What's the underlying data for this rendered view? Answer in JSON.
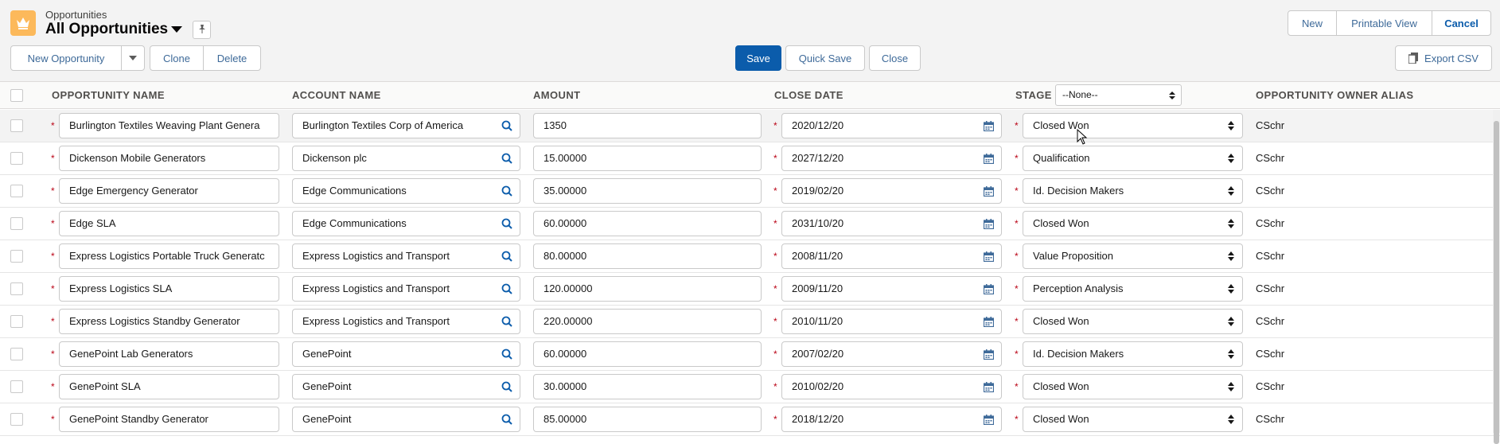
{
  "header": {
    "app_label": "Opportunities",
    "list_title": "All Opportunities",
    "buttons_left": [
      "New Opportunity",
      "Clone",
      "Delete"
    ],
    "buttons_center": [
      "Save",
      "Quick Save",
      "Close"
    ],
    "buttons_right_top": [
      "New",
      "Printable View",
      "Cancel"
    ],
    "export_label": "Export CSV"
  },
  "columns": {
    "name": "OPPORTUNITY NAME",
    "account": "ACCOUNT NAME",
    "amount": "AMOUNT",
    "close_date": "CLOSE DATE",
    "stage": "STAGE",
    "owner": "OPPORTUNITY OWNER ALIAS"
  },
  "stage_filter": "--None--",
  "rows": [
    {
      "name": "Burlington Textiles Weaving Plant Genera",
      "account": "Burlington Textiles Corp of America",
      "amount": "1350",
      "close_date": "2020/12/20",
      "stage": "Closed Won",
      "owner": "CSchr"
    },
    {
      "name": "Dickenson Mobile Generators",
      "account": "Dickenson plc",
      "amount": "15.00000",
      "close_date": "2027/12/20",
      "stage": "Qualification",
      "owner": "CSchr"
    },
    {
      "name": "Edge Emergency Generator",
      "account": "Edge Communications",
      "amount": "35.00000",
      "close_date": "2019/02/20",
      "stage": "Id. Decision Makers",
      "owner": "CSchr"
    },
    {
      "name": "Edge SLA",
      "account": "Edge Communications",
      "amount": "60.00000",
      "close_date": "2031/10/20",
      "stage": "Closed Won",
      "owner": "CSchr"
    },
    {
      "name": "Express Logistics Portable Truck Generatc",
      "account": "Express Logistics and Transport",
      "amount": "80.00000",
      "close_date": "2008/11/20",
      "stage": "Value Proposition",
      "owner": "CSchr"
    },
    {
      "name": "Express Logistics SLA",
      "account": "Express Logistics and Transport",
      "amount": "120.00000",
      "close_date": "2009/11/20",
      "stage": "Perception Analysis",
      "owner": "CSchr"
    },
    {
      "name": "Express Logistics Standby Generator",
      "account": "Express Logistics and Transport",
      "amount": "220.00000",
      "close_date": "2010/11/20",
      "stage": "Closed Won",
      "owner": "CSchr"
    },
    {
      "name": "GenePoint Lab Generators",
      "account": "GenePoint",
      "amount": "60.00000",
      "close_date": "2007/02/20",
      "stage": "Id. Decision Makers",
      "owner": "CSchr"
    },
    {
      "name": "GenePoint SLA",
      "account": "GenePoint",
      "amount": "30.00000",
      "close_date": "2010/02/20",
      "stage": "Closed Won",
      "owner": "CSchr"
    },
    {
      "name": "GenePoint Standby Generator",
      "account": "GenePoint",
      "amount": "85.00000",
      "close_date": "2018/12/20",
      "stage": "Closed Won",
      "owner": "CSchr"
    }
  ],
  "icons": {
    "app": "crown-icon",
    "pin": "pin-icon",
    "search": "search-icon",
    "calendar": "calendar-icon",
    "export": "copy-icon"
  },
  "colors": {
    "brand": "#0b5cab",
    "app_icon": "#fcb95b",
    "required": "#ba0517"
  }
}
